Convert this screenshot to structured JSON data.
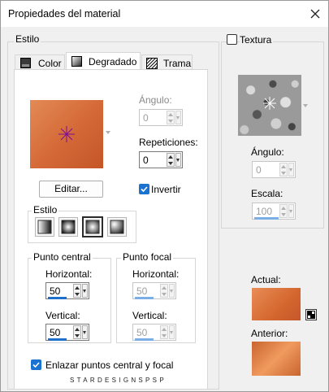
{
  "window": {
    "title": "Propiedades del material"
  },
  "left": {
    "section_label": "Estilo",
    "tabs": [
      {
        "label": "Color"
      },
      {
        "label": "Degradado"
      },
      {
        "label": "Trama"
      }
    ],
    "angle": {
      "label": "Ángulo:",
      "value": "0"
    },
    "repetitions": {
      "label": "Repeticiones:",
      "value": "0"
    },
    "edit_button": "Editar...",
    "invert": {
      "label": "Invertir",
      "checked": true
    },
    "style_group": {
      "label": "Estilo"
    },
    "central_point": {
      "label": "Punto central",
      "horizontal": {
        "label": "Horizontal:",
        "value": "50"
      },
      "vertical": {
        "label": "Vertical:",
        "value": "50"
      }
    },
    "focal_point": {
      "label": "Punto focal",
      "horizontal": {
        "label": "Horizontal:",
        "value": "50"
      },
      "vertical": {
        "label": "Vertical:",
        "value": "50"
      }
    },
    "link_points": {
      "label": "Enlazar puntos central y focal",
      "checked": true
    },
    "watermark": "STARDESIGNSPSP"
  },
  "right": {
    "texture": {
      "label": "Textura",
      "checked": false
    },
    "angle": {
      "label": "Ángulo:",
      "value": "0"
    },
    "scale": {
      "label": "Escala:",
      "value": "100"
    },
    "current": {
      "label": "Actual:"
    },
    "previous": {
      "label": "Anterior:"
    }
  },
  "colors": {
    "gradient_light": "#e8824a",
    "gradient_dark": "#c95a2c",
    "checkbox_blue": "#1a73d0",
    "progress_blue": "#1e6fcc"
  }
}
